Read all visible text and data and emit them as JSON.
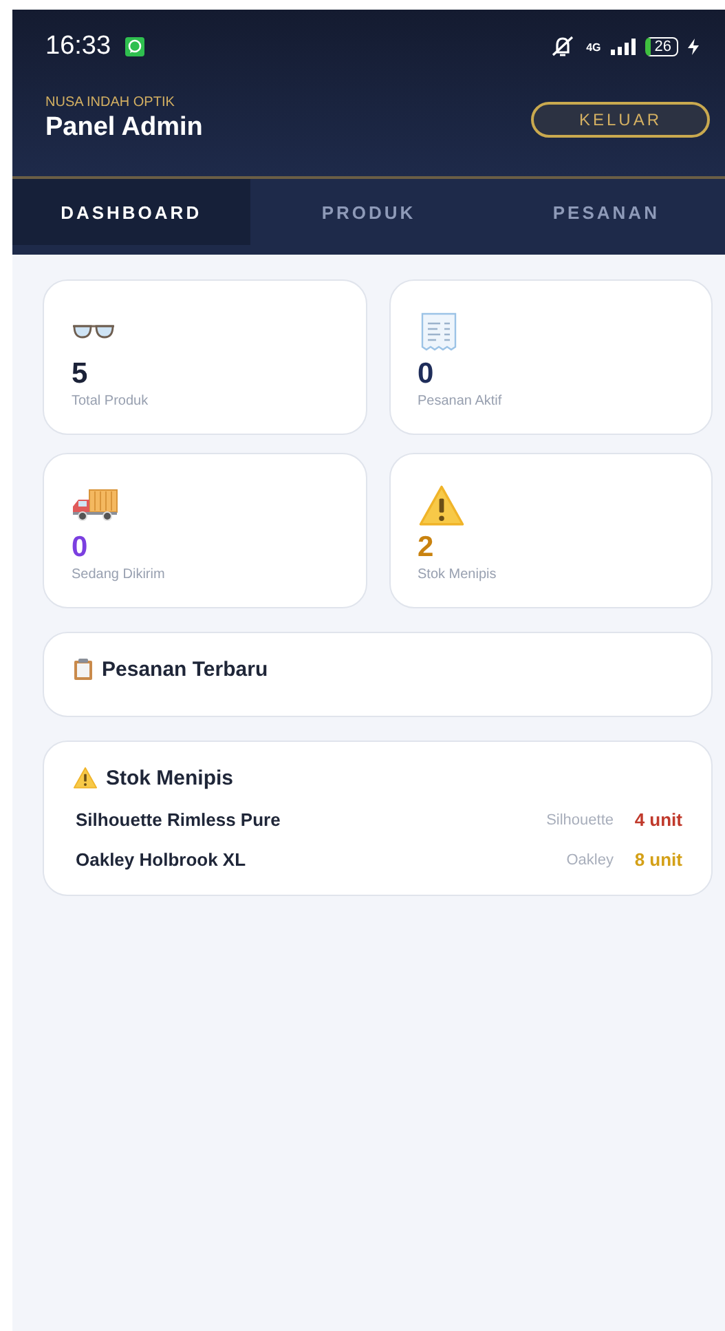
{
  "status_bar": {
    "time": "16:33",
    "network": "4G",
    "battery": "26"
  },
  "header": {
    "subtitle": "NUSA INDAH OPTIK",
    "title": "Panel Admin",
    "logout_button": "KELUAR"
  },
  "tabs": [
    {
      "label": "DASHBOARD",
      "selected": true
    },
    {
      "label": "PRODUK",
      "selected": false
    },
    {
      "label": "PESANAN",
      "selected": false
    }
  ],
  "stats": [
    {
      "kind": "glasses",
      "value": "5",
      "label": "Total Produk",
      "color": "#1b2238"
    },
    {
      "kind": "receipt",
      "value": "0",
      "label": "Pesanan Aktif",
      "color": "#1f2d5a"
    },
    {
      "kind": "truck",
      "value": "0",
      "label": "Sedang Dikirim",
      "color": "#7b3fe0"
    },
    {
      "kind": "warning",
      "value": "2",
      "label": "Stok Menipis",
      "color": "#c9820f"
    }
  ],
  "recent_orders": {
    "title": "Pesanan Terbaru"
  },
  "low_stock": {
    "title": "Stok Menipis",
    "items": [
      {
        "name": "Silhouette Rimless Pure",
        "brand": "Silhouette",
        "stock": "4 unit",
        "color": "#c0392b"
      },
      {
        "name": "Oakley Holbrook XL",
        "brand": "Oakley",
        "stock": "8 unit",
        "color": "#d4a017"
      }
    ]
  }
}
